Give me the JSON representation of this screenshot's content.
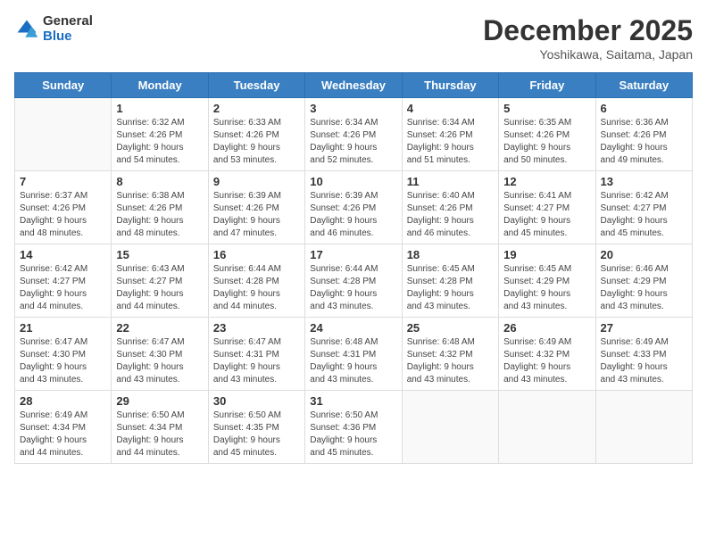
{
  "header": {
    "logo_general": "General",
    "logo_blue": "Blue",
    "month": "December 2025",
    "location": "Yoshikawa, Saitama, Japan"
  },
  "days_of_week": [
    "Sunday",
    "Monday",
    "Tuesday",
    "Wednesday",
    "Thursday",
    "Friday",
    "Saturday"
  ],
  "weeks": [
    [
      {
        "day": "",
        "info": ""
      },
      {
        "day": "1",
        "info": "Sunrise: 6:32 AM\nSunset: 4:26 PM\nDaylight: 9 hours\nand 54 minutes."
      },
      {
        "day": "2",
        "info": "Sunrise: 6:33 AM\nSunset: 4:26 PM\nDaylight: 9 hours\nand 53 minutes."
      },
      {
        "day": "3",
        "info": "Sunrise: 6:34 AM\nSunset: 4:26 PM\nDaylight: 9 hours\nand 52 minutes."
      },
      {
        "day": "4",
        "info": "Sunrise: 6:34 AM\nSunset: 4:26 PM\nDaylight: 9 hours\nand 51 minutes."
      },
      {
        "day": "5",
        "info": "Sunrise: 6:35 AM\nSunset: 4:26 PM\nDaylight: 9 hours\nand 50 minutes."
      },
      {
        "day": "6",
        "info": "Sunrise: 6:36 AM\nSunset: 4:26 PM\nDaylight: 9 hours\nand 49 minutes."
      }
    ],
    [
      {
        "day": "7",
        "info": "Sunrise: 6:37 AM\nSunset: 4:26 PM\nDaylight: 9 hours\nand 48 minutes."
      },
      {
        "day": "8",
        "info": "Sunrise: 6:38 AM\nSunset: 4:26 PM\nDaylight: 9 hours\nand 48 minutes."
      },
      {
        "day": "9",
        "info": "Sunrise: 6:39 AM\nSunset: 4:26 PM\nDaylight: 9 hours\nand 47 minutes."
      },
      {
        "day": "10",
        "info": "Sunrise: 6:39 AM\nSunset: 4:26 PM\nDaylight: 9 hours\nand 46 minutes."
      },
      {
        "day": "11",
        "info": "Sunrise: 6:40 AM\nSunset: 4:26 PM\nDaylight: 9 hours\nand 46 minutes."
      },
      {
        "day": "12",
        "info": "Sunrise: 6:41 AM\nSunset: 4:27 PM\nDaylight: 9 hours\nand 45 minutes."
      },
      {
        "day": "13",
        "info": "Sunrise: 6:42 AM\nSunset: 4:27 PM\nDaylight: 9 hours\nand 45 minutes."
      }
    ],
    [
      {
        "day": "14",
        "info": "Sunrise: 6:42 AM\nSunset: 4:27 PM\nDaylight: 9 hours\nand 44 minutes."
      },
      {
        "day": "15",
        "info": "Sunrise: 6:43 AM\nSunset: 4:27 PM\nDaylight: 9 hours\nand 44 minutes."
      },
      {
        "day": "16",
        "info": "Sunrise: 6:44 AM\nSunset: 4:28 PM\nDaylight: 9 hours\nand 44 minutes."
      },
      {
        "day": "17",
        "info": "Sunrise: 6:44 AM\nSunset: 4:28 PM\nDaylight: 9 hours\nand 43 minutes."
      },
      {
        "day": "18",
        "info": "Sunrise: 6:45 AM\nSunset: 4:28 PM\nDaylight: 9 hours\nand 43 minutes."
      },
      {
        "day": "19",
        "info": "Sunrise: 6:45 AM\nSunset: 4:29 PM\nDaylight: 9 hours\nand 43 minutes."
      },
      {
        "day": "20",
        "info": "Sunrise: 6:46 AM\nSunset: 4:29 PM\nDaylight: 9 hours\nand 43 minutes."
      }
    ],
    [
      {
        "day": "21",
        "info": "Sunrise: 6:47 AM\nSunset: 4:30 PM\nDaylight: 9 hours\nand 43 minutes."
      },
      {
        "day": "22",
        "info": "Sunrise: 6:47 AM\nSunset: 4:30 PM\nDaylight: 9 hours\nand 43 minutes."
      },
      {
        "day": "23",
        "info": "Sunrise: 6:47 AM\nSunset: 4:31 PM\nDaylight: 9 hours\nand 43 minutes."
      },
      {
        "day": "24",
        "info": "Sunrise: 6:48 AM\nSunset: 4:31 PM\nDaylight: 9 hours\nand 43 minutes."
      },
      {
        "day": "25",
        "info": "Sunrise: 6:48 AM\nSunset: 4:32 PM\nDaylight: 9 hours\nand 43 minutes."
      },
      {
        "day": "26",
        "info": "Sunrise: 6:49 AM\nSunset: 4:32 PM\nDaylight: 9 hours\nand 43 minutes."
      },
      {
        "day": "27",
        "info": "Sunrise: 6:49 AM\nSunset: 4:33 PM\nDaylight: 9 hours\nand 43 minutes."
      }
    ],
    [
      {
        "day": "28",
        "info": "Sunrise: 6:49 AM\nSunset: 4:34 PM\nDaylight: 9 hours\nand 44 minutes."
      },
      {
        "day": "29",
        "info": "Sunrise: 6:50 AM\nSunset: 4:34 PM\nDaylight: 9 hours\nand 44 minutes."
      },
      {
        "day": "30",
        "info": "Sunrise: 6:50 AM\nSunset: 4:35 PM\nDaylight: 9 hours\nand 45 minutes."
      },
      {
        "day": "31",
        "info": "Sunrise: 6:50 AM\nSunset: 4:36 PM\nDaylight: 9 hours\nand 45 minutes."
      },
      {
        "day": "",
        "info": ""
      },
      {
        "day": "",
        "info": ""
      },
      {
        "day": "",
        "info": ""
      }
    ]
  ]
}
